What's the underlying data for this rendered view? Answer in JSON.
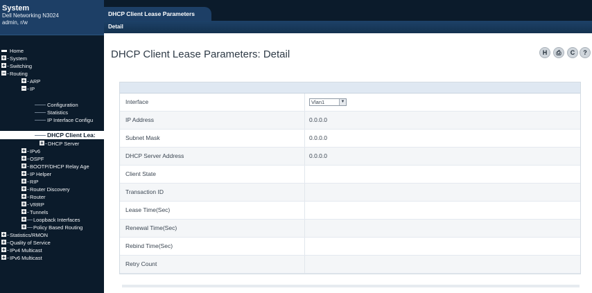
{
  "sidebar": {
    "title": "System",
    "model": "Dell Networking N3024",
    "user": "admin, r/w",
    "items": [
      {
        "label": "Home",
        "icon": "home-icon"
      },
      {
        "label": "System"
      },
      {
        "label": "Switching"
      },
      {
        "label": "Routing"
      },
      {
        "label": "ARP"
      },
      {
        "label": "IP"
      },
      {
        "label": "Configuration"
      },
      {
        "label": "Statistics"
      },
      {
        "label": "IP Interface Configu"
      },
      {
        "label": "DHCP Client Lea:"
      },
      {
        "label": "DHCP Server"
      },
      {
        "label": "IPv6"
      },
      {
        "label": "OSPF"
      },
      {
        "label": "BOOTP/DHCP Relay Age"
      },
      {
        "label": "IP Helper"
      },
      {
        "label": "RIP"
      },
      {
        "label": "Router Discovery"
      },
      {
        "label": "Router"
      },
      {
        "label": "VRRP"
      },
      {
        "label": "Tunnels"
      },
      {
        "label": "Loopback Interfaces"
      },
      {
        "label": "Policy Based Routing"
      },
      {
        "label": "Statistics/RMON"
      },
      {
        "label": "Quality of Service"
      },
      {
        "label": "IPv4 Multicast"
      },
      {
        "label": "IPv6 Multicast"
      }
    ]
  },
  "tabs": {
    "main_tab": "DHCP Client Lease Parameters",
    "sub_tab": "Detail"
  },
  "main": {
    "title": "DHCP Client Lease Parameters: Detail",
    "toolbar": [
      {
        "glyph": "H",
        "icon": "help-h-icon"
      },
      {
        "glyph": "⎙",
        "icon": "print-icon"
      },
      {
        "glyph": "C",
        "icon": "refresh-icon"
      },
      {
        "glyph": "?",
        "icon": "question-icon"
      }
    ]
  },
  "table": {
    "rows": [
      {
        "label": "Interface",
        "value": "Vlan1"
      },
      {
        "label": "IP Address",
        "value": "0.0.0.0"
      },
      {
        "label": "Subnet Mask",
        "value": "0.0.0.0"
      },
      {
        "label": "DHCP Server Address",
        "value": "0.0.0.0"
      },
      {
        "label": "Client State",
        "value": ""
      },
      {
        "label": "Transaction ID",
        "value": ""
      },
      {
        "label": "Lease Time(Sec)",
        "value": ""
      },
      {
        "label": "Renewal Time(Sec)",
        "value": ""
      },
      {
        "label": "Rebind Time(Sec)",
        "value": ""
      },
      {
        "label": "Retry Count",
        "value": ""
      }
    ]
  },
  "colors": {
    "sidebar_bg": "#0b1b2b",
    "header_bg": "#1d3f66",
    "table_header": "#dfe8f2"
  }
}
